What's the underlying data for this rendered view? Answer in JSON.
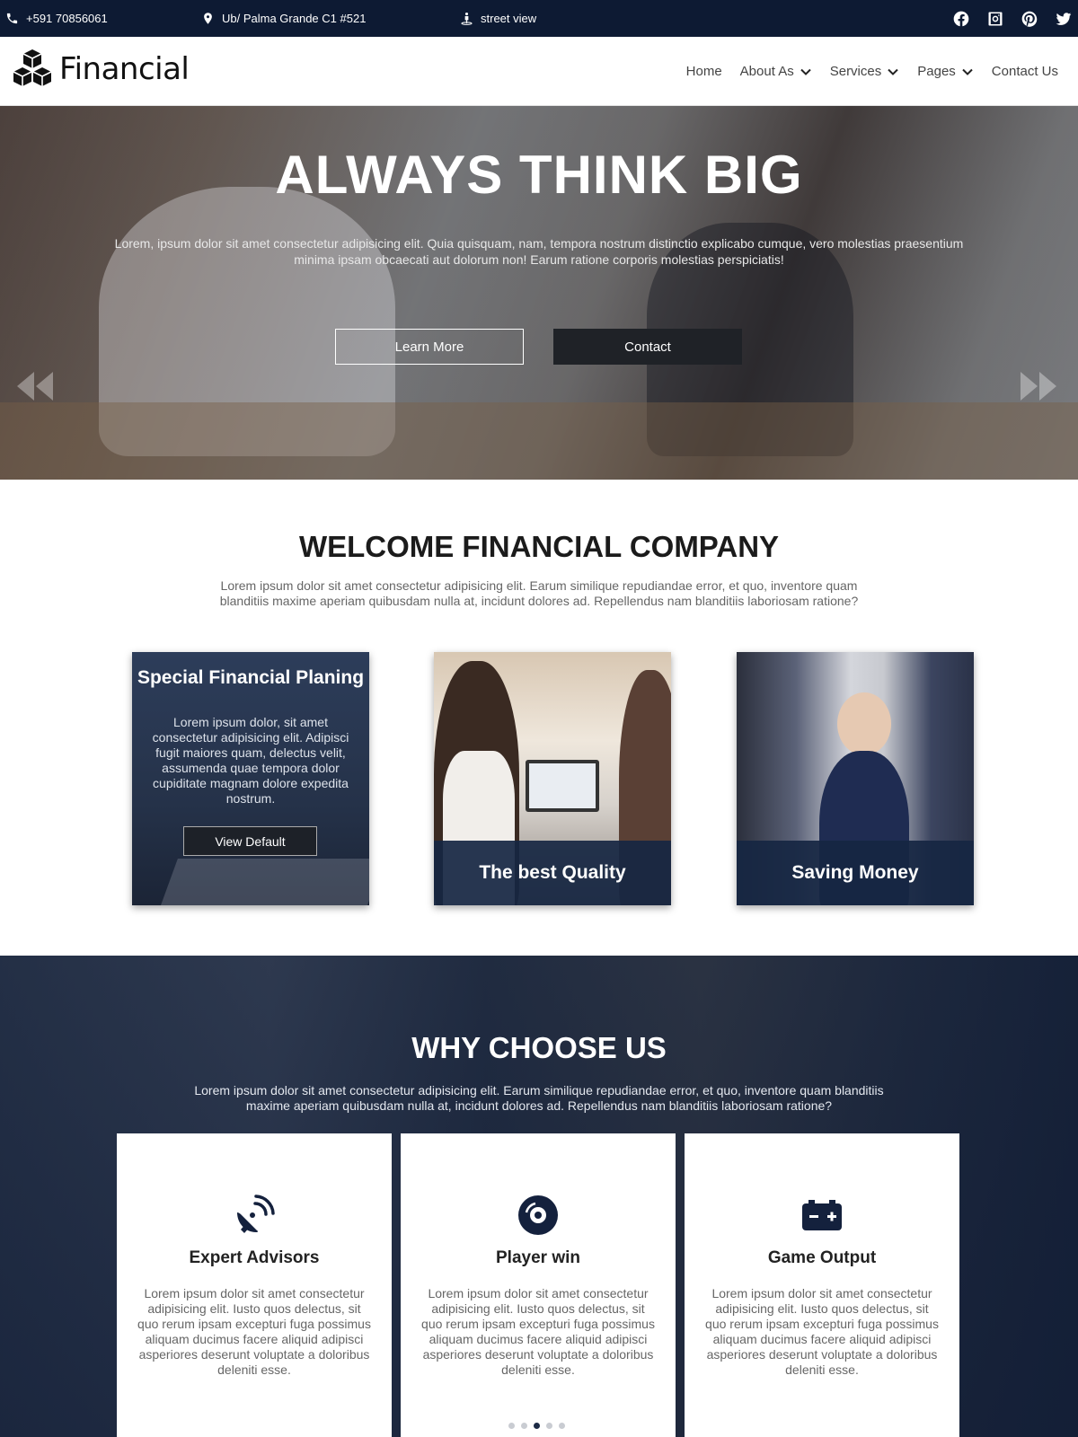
{
  "topbar": {
    "phone": "+591 70856061",
    "address": "Ub/ Palma Grande C1 #521",
    "street_view": "street view",
    "social": [
      "facebook-icon",
      "instagram-icon",
      "pinterest-icon",
      "twitter-icon"
    ]
  },
  "header": {
    "logo": "Financial",
    "nav": [
      {
        "label": "Home",
        "dropdown": false
      },
      {
        "label": "About As",
        "dropdown": true
      },
      {
        "label": "Services",
        "dropdown": true
      },
      {
        "label": "Pages",
        "dropdown": true
      },
      {
        "label": "Contact Us",
        "dropdown": false
      }
    ]
  },
  "hero": {
    "title": "ALWAYS THINK BIG",
    "text": "Lorem, ipsum dolor sit amet consectetur adipisicing elit. Quia quisquam, nam, tempora nostrum distinctio explicabo cumque, vero molestias praesentium minima ipsam obcaecati aut dolorum non! Earum ratione corporis molestias perspiciatis!",
    "learn_more": "Learn More",
    "contact": "Contact"
  },
  "welcome": {
    "title": "WELCOME FINANCIAL COMPANY",
    "text": "Lorem ipsum dolor sit amet consectetur adipisicing elit. Earum similique repudiandae error, et quo, inventore quam blanditiis maxime aperiam quibusdam nulla at, incidunt dolores ad. Repellendus nam blanditiis laboriosam ratione?",
    "cards": [
      {
        "title": "Special Financial Planing",
        "text": "Lorem ipsum dolor, sit amet consectetur adipisicing elit. Adipisci fugit maiores quam, delectus velit, assumenda quae tempora dolor cupiditate magnam dolore expedita nostrum.",
        "button": "View Default"
      },
      {
        "caption": "The best Quality"
      },
      {
        "caption": "Saving Money"
      }
    ]
  },
  "why": {
    "title": "WHY CHOOSE US",
    "text": "Lorem ipsum dolor sit amet consectetur adipisicing elit. Earum similique repudiandae error, et quo, inventore quam blanditiis maxime aperiam quibusdam nulla at, incidunt dolores ad. Repellendus nam blanditiis laboriosam ratione?",
    "features": [
      {
        "icon": "satellite-dish-icon",
        "title": "Expert Advisors",
        "text": "Lorem ipsum dolor sit amet consectetur adipisicing elit. Iusto quos delectus, sit quo rerum ipsam excepturi fuga possimus aliquam ducimus facere aliquid adipisci asperiores deserunt voluptate a doloribus deleniti esse."
      },
      {
        "icon": "compact-disc-icon",
        "title": "Player win",
        "text": "Lorem ipsum dolor sit amet consectetur adipisicing elit. Iusto quos delectus, sit quo rerum ipsam excepturi fuga possimus aliquam ducimus facere aliquid adipisci asperiores deserunt voluptate a doloribus deleniti esse."
      },
      {
        "icon": "battery-icon",
        "title": "Game Output",
        "text": "Lorem ipsum dolor sit amet consectetur adipisicing elit. Iusto quos delectus, sit quo rerum ipsam excepturi fuga possimus aliquam ducimus facere aliquid adipisci asperiores deserunt voluptate a doloribus deleniti esse."
      }
    ],
    "carousel_active_index": 2,
    "carousel_count": 5
  },
  "colors": {
    "topbar_bg": "#0d1a33",
    "accent_dark": "#1c2a45",
    "button_dark": "#1f2227"
  }
}
